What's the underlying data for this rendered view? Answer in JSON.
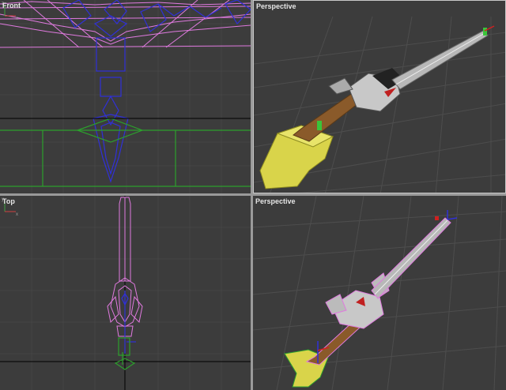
{
  "viewports": {
    "front": {
      "label": "Front"
    },
    "top": {
      "label": "Top"
    },
    "perspective_top": {
      "label": "Perspective"
    },
    "perspective_bottom": {
      "label": "Perspective"
    }
  },
  "colors": {
    "viewport_bg": "#3c3c3c",
    "grid_line": "#4a4a4a",
    "wire_pink": "#e07adf",
    "wire_blue": "#3030d8",
    "wire_green": "#2ca02c",
    "mesh_yellow": "#d9d44a"
  }
}
